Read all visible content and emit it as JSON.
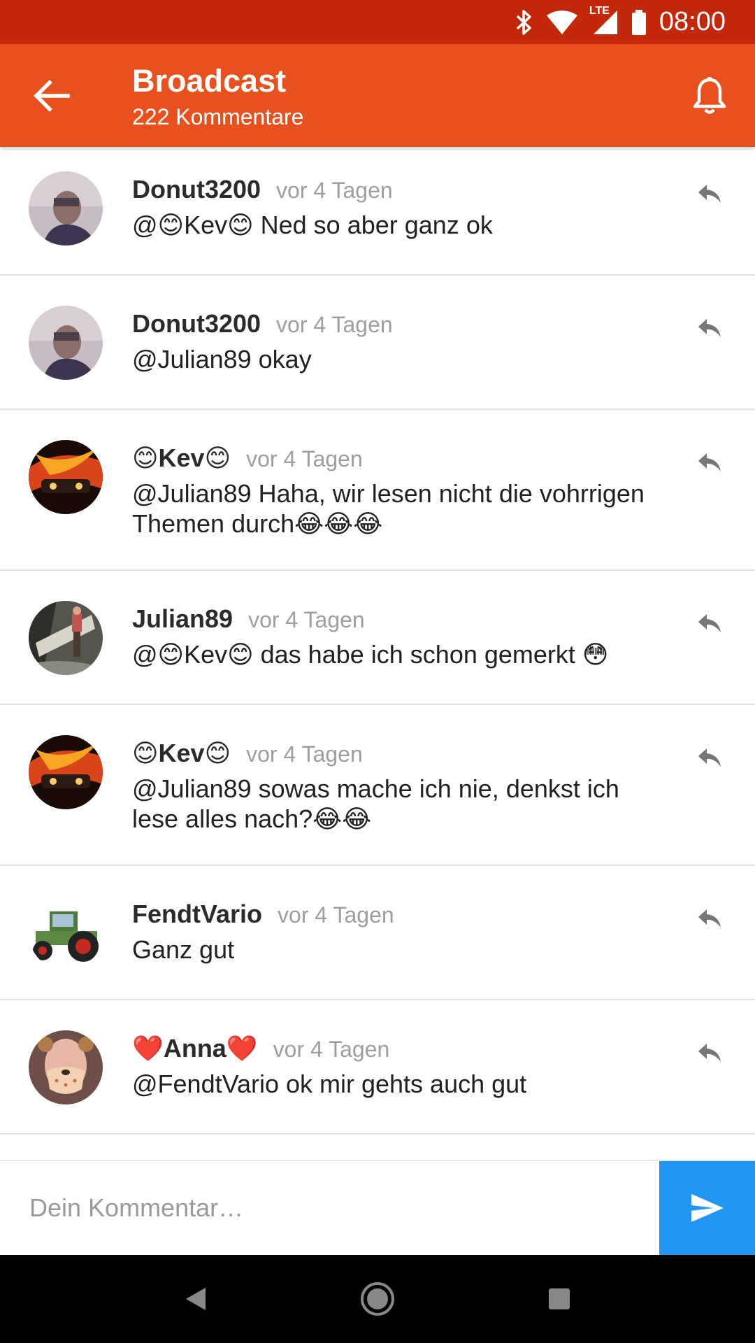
{
  "status_bar": {
    "time": "08:00",
    "network": "LTE"
  },
  "header": {
    "title": "Broadcast",
    "subtitle": "222 Kommentare"
  },
  "comments": [
    {
      "author": "Donut3200",
      "time": "vor 4 Tagen",
      "text": "@😊Kev😊 Ned so aber ganz ok",
      "avatar": "avatar-photo"
    },
    {
      "author": "Donut3200",
      "time": "vor 4 Tagen",
      "text": "@Julian89 okay",
      "avatar": "avatar-photo"
    },
    {
      "author": "😊Kev😊",
      "time": "vor 4 Tagen",
      "text": "@Julian89 Haha, wir lesen nicht die vohrrigen Themen durch😂😂😂",
      "avatar": "avatar-fire"
    },
    {
      "author": "Julian89",
      "time": "vor 4 Tagen",
      "text": "@😊Kev😊 das habe ich schon gemerkt 😳",
      "avatar": "avatar-forest"
    },
    {
      "author": "😊Kev😊",
      "time": "vor 4 Tagen",
      "text": "@Julian89 sowas mache ich nie, denkst ich lese alles nach?😂😂",
      "avatar": "avatar-fire"
    },
    {
      "author": "FendtVario",
      "time": "vor 4 Tagen",
      "text": "Ganz gut",
      "avatar": "avatar-tractor"
    },
    {
      "author": "❤️Anna❤️",
      "time": "vor 4 Tagen",
      "text": "@FendtVario ok mir gehts auch gut",
      "avatar": "avatar-filter"
    }
  ],
  "composer": {
    "placeholder": "Dein Kommentar…"
  },
  "colors": {
    "status_bar": "#c4280a",
    "app_bar": "#e8501d",
    "send_button": "#2196f3",
    "divider": "#e3e3e3"
  },
  "icons": [
    "back-arrow-icon",
    "bell-icon",
    "reply-icon",
    "send-icon",
    "bluetooth-icon",
    "wifi-icon",
    "signal-icon",
    "battery-icon",
    "nav-back-icon",
    "nav-home-icon",
    "nav-recents-icon"
  ]
}
